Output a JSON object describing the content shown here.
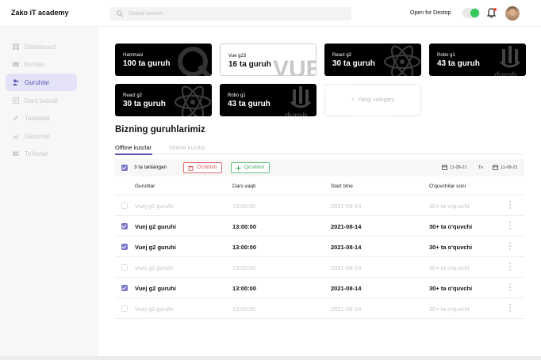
{
  "app": {
    "brand": "Zako iT academy"
  },
  "header": {
    "search_placeholder": "Global search",
    "open_label": "Open for Destop",
    "toggle_on": true
  },
  "sidebar": {
    "items": [
      {
        "label": "Dashboard",
        "icon": "dashboard-icon",
        "active": false
      },
      {
        "label": "Kurslar",
        "icon": "folder-icon",
        "active": false
      },
      {
        "label": "Guruhlar",
        "icon": "users-icon",
        "active": true
      },
      {
        "label": "Dars jadvali",
        "icon": "table-icon",
        "active": false
      },
      {
        "label": "Talabalar",
        "icon": "pencil-icon",
        "active": false
      },
      {
        "label": "Davomat",
        "icon": "chart-icon",
        "active": false
      },
      {
        "label": "To'lovlar",
        "icon": "wallet-icon",
        "active": false
      }
    ]
  },
  "cards": [
    {
      "name": "Hammasi",
      "count": "100 ta guruh",
      "style": "dark",
      "deco": "zako-logo"
    },
    {
      "name": "Vue g23",
      "count": "16 ta guruh",
      "style": "light",
      "deco": "vue-logo"
    },
    {
      "name": "React g2",
      "count": "30 ta guruh",
      "style": "dark",
      "deco": "react-logo"
    },
    {
      "name": "Robo g1",
      "count": "43 ta guruh",
      "style": "dark",
      "deco": "durob-logo"
    },
    {
      "name": "React g2",
      "count": "30 ta guruh",
      "style": "dark",
      "deco": "react-logo"
    },
    {
      "name": "Robo g1",
      "count": "43 ta guruh",
      "style": "dark",
      "deco": "durob-logo"
    }
  ],
  "add_category_label": "Yangi category",
  "section_title": "Bizning guruhlarimiz",
  "tabs": [
    {
      "label": "Offline kusrlar",
      "active": true
    },
    {
      "label": "Online kusrlar",
      "active": false
    }
  ],
  "toolbar": {
    "selected_label": "3 ta tanlangan",
    "delete_label": "O'chirish",
    "add_label": "Qo'shish",
    "date_from": "11-08-21",
    "to_label": "To",
    "date_to": "11-08-21"
  },
  "table": {
    "headers": [
      "Guruhlar",
      "Dars vaqti",
      "Start time",
      "O'quvchilar soni"
    ],
    "rows": [
      {
        "selected": false,
        "name": "Vuej g2 guruhi",
        "time": "13:00:00",
        "start": "2021-08-14",
        "students": "30+ ta o'quvchi"
      },
      {
        "selected": true,
        "name": "Vuej g2 guruhi",
        "time": "13:00:00",
        "start": "2021-08-14",
        "students": "30+ ta o'quvchi"
      },
      {
        "selected": true,
        "name": "Vuej g2 guruhi",
        "time": "13:00:00",
        "start": "2021-08-14",
        "students": "30+ ta o'quvchi"
      },
      {
        "selected": false,
        "name": "Vuej g2 guruhi",
        "time": "13:00:00",
        "start": "2021-08-14",
        "students": "30+ ta o'quvchi"
      },
      {
        "selected": true,
        "name": "Vuej g2 guruhi",
        "time": "13:00:00",
        "start": "2021-08-14",
        "students": "30+ ta o'quvchi"
      },
      {
        "selected": false,
        "name": "Vuej g2 guruhi",
        "time": "13:00:00",
        "start": "2021-08-14",
        "students": "30+ ta o'quvchi"
      }
    ]
  },
  "colors": {
    "accent": "#5a56b5",
    "toggle": "#34c759",
    "danger": "#d9534f",
    "success": "#3aa357"
  }
}
